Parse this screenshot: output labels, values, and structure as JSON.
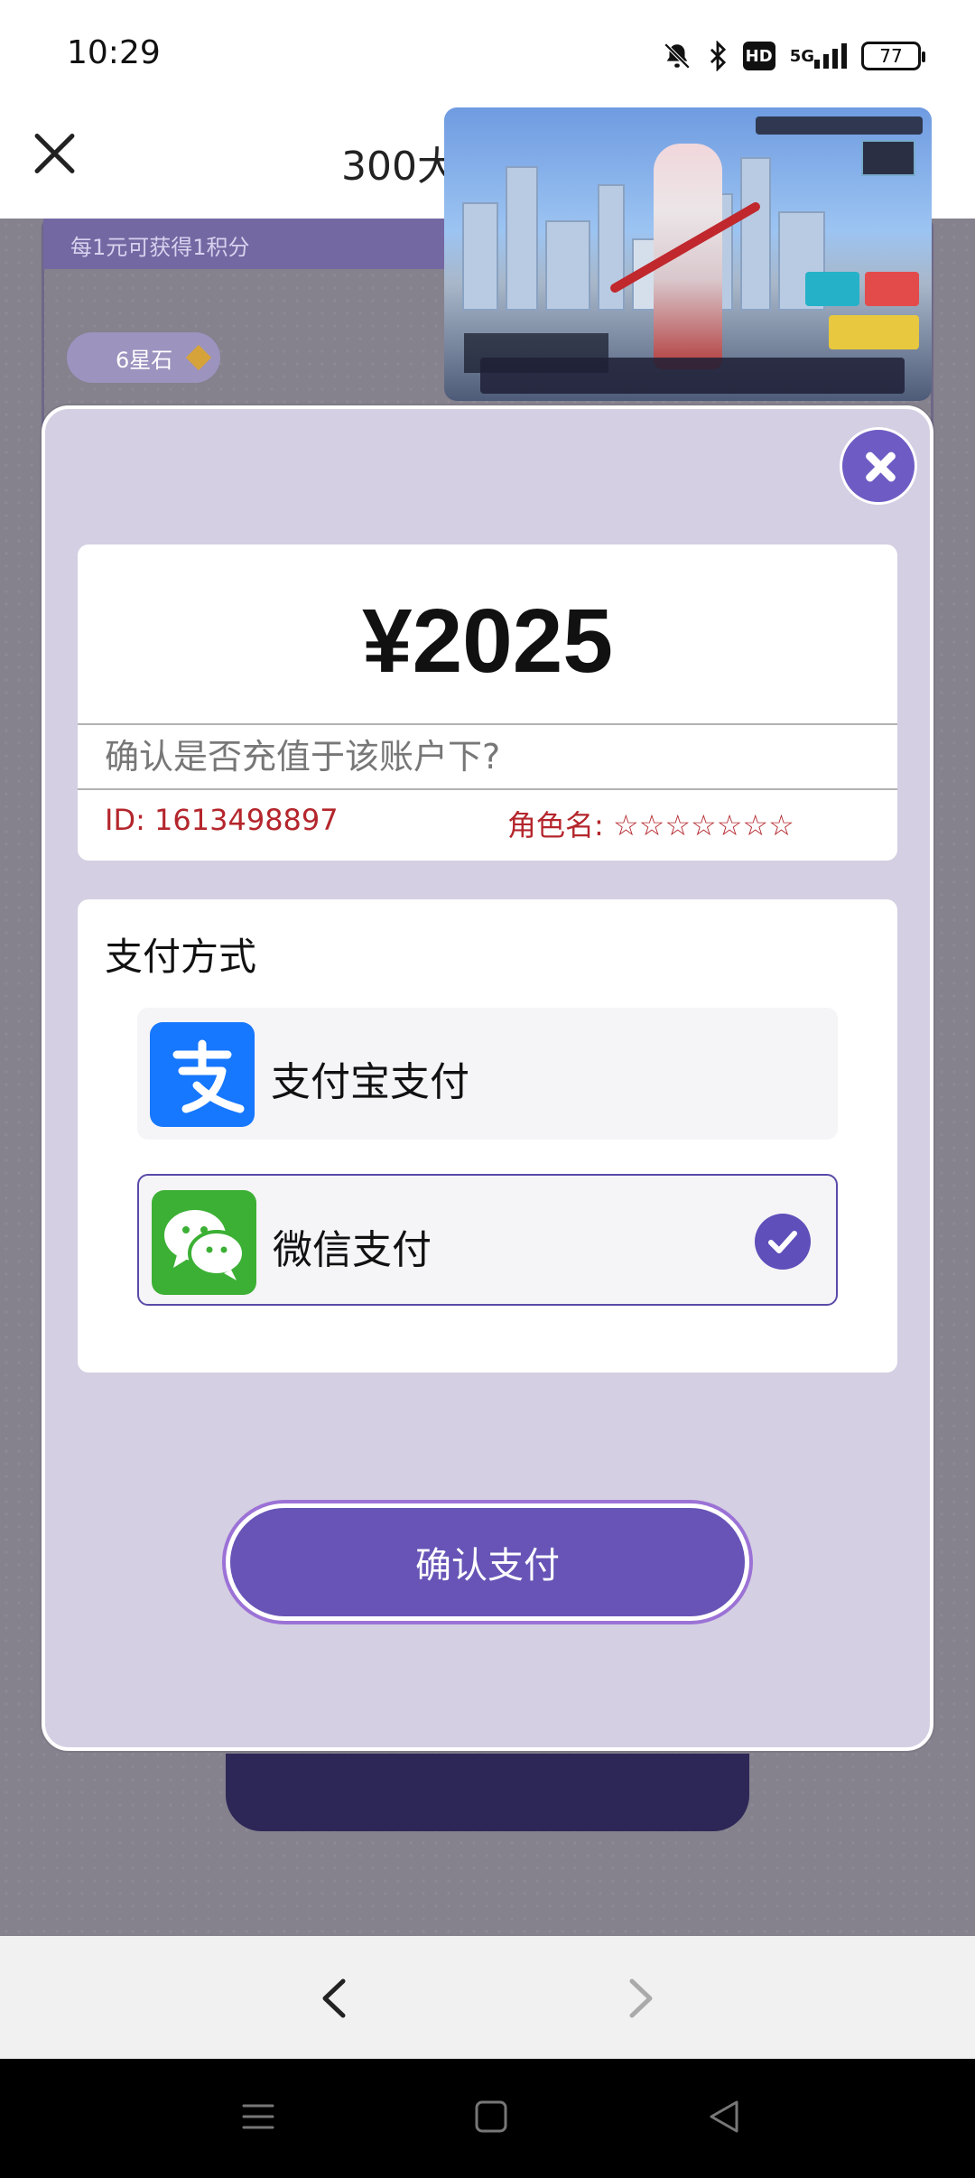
{
  "status_bar": {
    "time": "10:29",
    "network": "5G",
    "hd_label": "HD",
    "battery": "77",
    "icons": [
      "mute-bell-icon",
      "bluetooth-icon",
      "hd-icon",
      "5g-signal-icon",
      "battery-icon"
    ]
  },
  "header": {
    "title": "300大",
    "close_icon": "close-icon"
  },
  "background": {
    "points_text": "每1元可获得1积分",
    "tag_text": "6星石"
  },
  "modal": {
    "amount": "¥2025",
    "confirm_question": "确认是否充值于该账户下?",
    "account_id": "ID: 1613498897",
    "role_label": "角色名: ☆☆☆☆☆☆☆",
    "payment": {
      "title": "支付方式",
      "options": [
        {
          "label": "支付宝支付",
          "icon": "alipay-icon",
          "selected": false
        },
        {
          "label": "微信支付",
          "icon": "wechat-pay-icon",
          "selected": true
        }
      ]
    },
    "confirm_button": "确认支付"
  },
  "browser_nav": {
    "back_icon": "chevron-left-icon",
    "forward_icon": "chevron-right-icon"
  },
  "system_nav": {
    "icons": [
      "menu-icon",
      "home-icon",
      "back-triangle-icon"
    ]
  },
  "colors": {
    "accent": "#6754b6",
    "modal_bg": "#d4cfe2",
    "error_red": "#b4262c",
    "alipay_blue": "#1677ff",
    "wechat_green": "#3cb035"
  }
}
